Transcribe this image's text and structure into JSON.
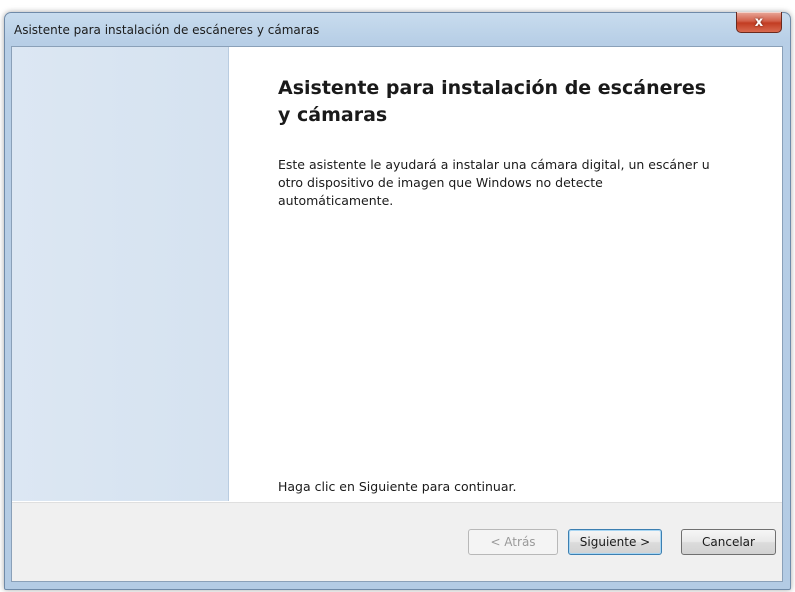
{
  "window": {
    "title": "Asistente para instalación de escáneres y cámaras",
    "close_label": "x"
  },
  "wizard": {
    "heading": "Asistente para instalación de escáneres y cámaras",
    "description": "Este asistente le ayudará a instalar una cámara digital, un escáner u otro dispositivo de imagen que Windows no detecte automáticamente.",
    "footer_hint": "Haga clic en Siguiente para continuar."
  },
  "buttons": {
    "back_label": "< Atrás",
    "next_label": "Siguiente >",
    "cancel_label": "Cancelar"
  },
  "colors": {
    "side_panel": "#d8e4f1",
    "frame": "#b7cee6",
    "close_button": "#c23c22"
  }
}
